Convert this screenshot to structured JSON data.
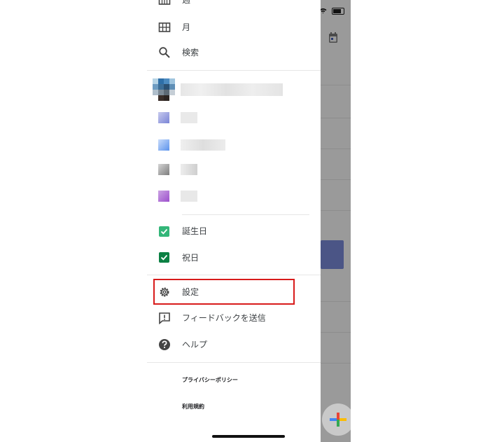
{
  "menu": {
    "week_label": "週",
    "month_label": "月",
    "search_label": "検索"
  },
  "calendars": {
    "birthdays_label": "誕生日",
    "holidays_label": "祝日",
    "checkbox_colors": {
      "birthdays": "#33b679",
      "holidays": "#0b8043"
    }
  },
  "footer_menu": {
    "settings_label": "設定",
    "feedback_label": "フィードバックを送信",
    "help_label": "ヘルプ"
  },
  "links": {
    "privacy_label": "プライバシーポリシー",
    "terms_label": "利用規約"
  },
  "colors": {
    "highlight": "#d81b1b",
    "fab_plus": [
      "#4285f4",
      "#ea4335",
      "#fbbc04",
      "#34a853"
    ]
  }
}
